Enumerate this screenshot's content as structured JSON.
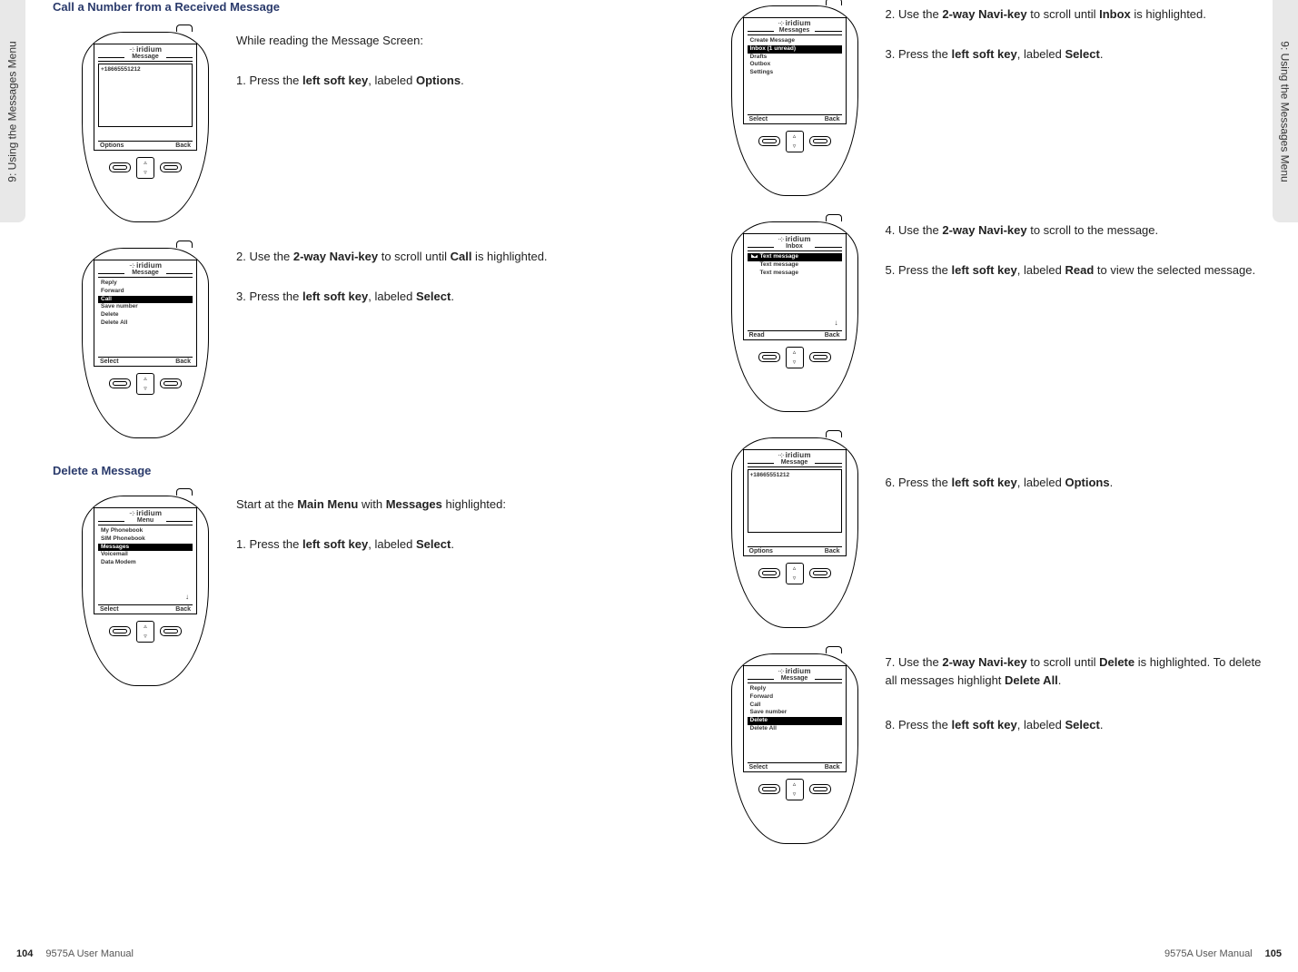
{
  "side_tab": "9: Using the Messages Menu",
  "manual_name": "9575A User Manual",
  "page_left_num": "104",
  "page_right_num": "105",
  "brand": "iridium",
  "left": {
    "heading1": "Call a Number from a Received Message",
    "heading2": "Delete a Message",
    "phone1": {
      "title": "Message",
      "body": "+18665551212",
      "sk_left": "Options",
      "sk_right": "Back"
    },
    "phone2": {
      "title": "Message",
      "items": [
        "Reply",
        "Forward",
        "Call",
        "Save number",
        "Delete",
        "Delete All"
      ],
      "hl_index": 2,
      "sk_left": "Select",
      "sk_right": "Back"
    },
    "phone3": {
      "title": "Menu",
      "items": [
        "My Phonebook",
        "SIM Phonebook",
        "Messages",
        "Voicemail",
        "Data Modem"
      ],
      "hl_index": 2,
      "sk_left": "Select",
      "sk_right": "Back"
    },
    "instr": {
      "i0": "While reading the Message Screen:",
      "i1_pre": "1. Press the ",
      "i1_b": "left soft key",
      "i1_mid": ", labeled ",
      "i1_b2": "Options",
      "i1_post": ".",
      "i2_pre": "2. Use the ",
      "i2_b": "2-way Navi-key",
      "i2_mid": " to scroll until ",
      "i2_b2": "Call",
      "i2_post": " is highlighted.",
      "i3_pre": "3. Press the ",
      "i3_b": "left soft key",
      "i3_mid": ", labeled ",
      "i3_b2": "Select",
      "i3_post": ".",
      "i4_pre": "Start at the ",
      "i4_b": "Main Menu",
      "i4_mid": " with ",
      "i4_b2": "Messages",
      "i4_post": " highlighted:",
      "i5_pre": "1. Press the ",
      "i5_b": "left soft key",
      "i5_mid": ", labeled ",
      "i5_b2": "Select",
      "i5_post": "."
    }
  },
  "right": {
    "phone4": {
      "title": "Messages",
      "items": [
        "Create Message",
        "Inbox (1 unread)",
        "Drafts",
        "Outbox",
        "Settings"
      ],
      "hl_index": 1,
      "sk_left": "Select",
      "sk_right": "Back"
    },
    "phone5": {
      "title": "Inbox",
      "items": [
        "Text message",
        "Text message",
        "Text message"
      ],
      "hl_index": 0,
      "sk_left": "Read",
      "sk_right": "Back"
    },
    "phone6": {
      "title": "Message",
      "body": "+18665551212",
      "sk_left": "Options",
      "sk_right": "Back"
    },
    "phone7": {
      "title": "Message",
      "items": [
        "Reply",
        "Forward",
        "Call",
        "Save number",
        "Delete",
        "Delete All"
      ],
      "hl_index": 4,
      "sk_left": "Select",
      "sk_right": "Back"
    },
    "instr": {
      "r2_pre": "2. Use the ",
      "r2_b": "2-way Navi-key",
      "r2_mid": " to scroll until ",
      "r2_b2": "Inbox",
      "r2_post": " is highlighted.",
      "r3_pre": "3. Press the ",
      "r3_b": "left soft key",
      "r3_mid": ", labeled ",
      "r3_b2": "Select",
      "r3_post": ".",
      "r4_pre": "4. Use the ",
      "r4_b": "2-way Navi-key",
      "r4_post": " to scroll to the message.",
      "r5_pre": "5. Press the ",
      "r5_b": "left soft key",
      "r5_mid": ", labeled ",
      "r5_b2": "Read",
      "r5_post": " to view the selected message.",
      "r6_pre": "6. Press the ",
      "r6_b": "left soft key",
      "r6_mid": ", labeled ",
      "r6_b2": "Options",
      "r6_post": ".",
      "r7_pre": "7. Use the ",
      "r7_b": "2-way Navi-key",
      "r7_mid": " to scroll until ",
      "r7_b2": "Delete",
      "r7_post1": " is highlighted. To delete all messages highlight ",
      "r7_b3": "Delete All",
      "r7_post2": ".",
      "r8_pre": "8. Press the ",
      "r8_b": "left soft key",
      "r8_mid": ", labeled ",
      "r8_b2": "Select",
      "r8_post": "."
    }
  }
}
